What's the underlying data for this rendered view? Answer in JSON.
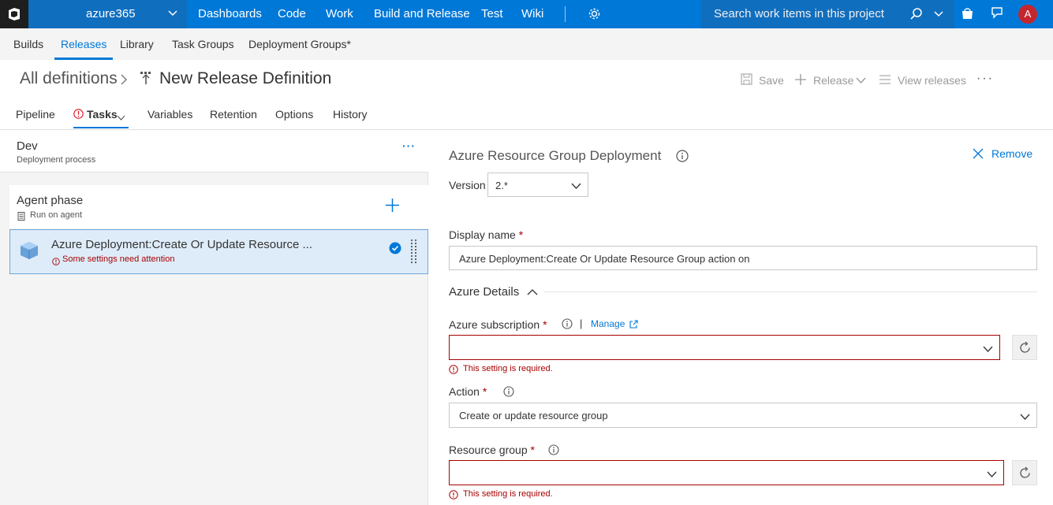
{
  "topbar": {
    "project": "azure365",
    "nav": [
      "Dashboards",
      "Code",
      "Work",
      "Build and Release",
      "Test",
      "Wiki"
    ],
    "search_placeholder": "Search work items in this project",
    "avatar_initial": "A"
  },
  "hubs": [
    "Builds",
    "Releases",
    "Library",
    "Task Groups",
    "Deployment Groups*"
  ],
  "title": {
    "breadcrumb": "All definitions",
    "definition": "New Release Definition",
    "save": "Save",
    "release": "Release",
    "view_releases": "View releases",
    "more": "···"
  },
  "tabs": [
    "Pipeline",
    "Tasks",
    "Variables",
    "Retention",
    "Options",
    "History"
  ],
  "left": {
    "env_name": "Dev",
    "env_sub": "Deployment process",
    "env_more": "···",
    "phase_name": "Agent phase",
    "phase_sub": "Run on agent",
    "task_name": "Azure Deployment:Create Or Update Resource ...",
    "task_warning": "Some settings need attention"
  },
  "right": {
    "title": "Azure Resource Group Deployment",
    "remove": "Remove",
    "version_label": "Version",
    "version_value": "2.*",
    "display_name_label": "Display name",
    "display_name_value": "Azure Deployment:Create Or Update Resource Group action on",
    "section": "Azure Details",
    "subscription_label": "Azure subscription",
    "manage": "Manage",
    "required_msg": "This setting is required.",
    "action_label": "Action",
    "action_value": "Create or update resource group",
    "rg_label": "Resource group",
    "asterisk": "*"
  }
}
